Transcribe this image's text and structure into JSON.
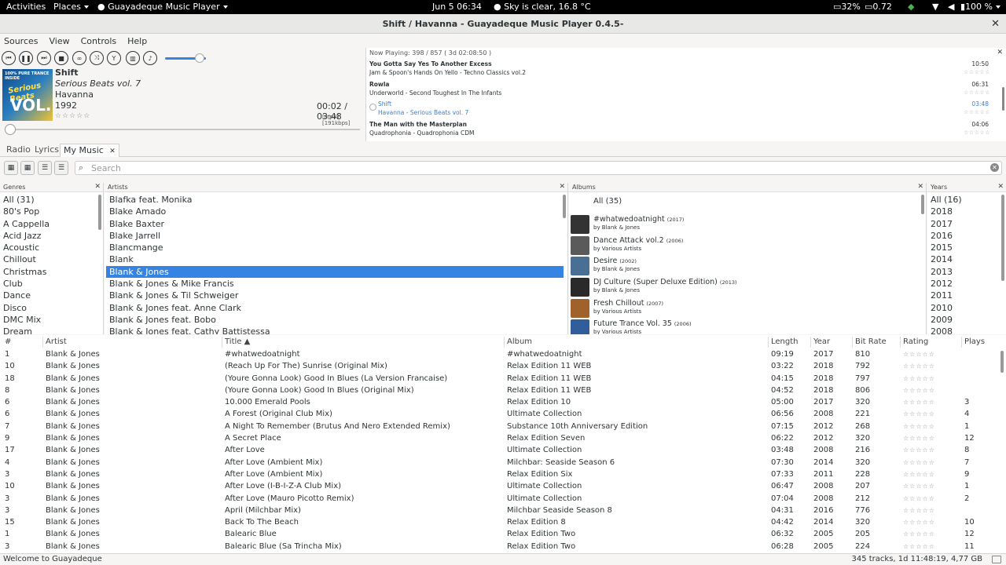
{
  "topbar": {
    "activities": "Activities",
    "places": "Places",
    "app_menu": "Guayadeque Music Player",
    "clock": "Jun 5  06:34",
    "weather": "Sky is clear, 16.8 °C",
    "cpu": "32%",
    "load": "0.72",
    "battery": "100 %"
  },
  "window": {
    "title": "Shift / Havanna - Guayadeque Music Player 0.4.5-"
  },
  "menu": [
    "Sources",
    "View",
    "Controls",
    "Help"
  ],
  "player": {
    "title": "Shift",
    "album": "Serious Beats vol. 7",
    "artist": "Havanna",
    "year": "1992",
    "rating": "☆☆☆☆☆",
    "time": "00:02 / 03:48",
    "format": "[mp3]  [191kbps]",
    "volume": 0.85,
    "cover_text": [
      "100% PURE TRANCE INSIDE",
      "Serious Beats",
      "VOL.7"
    ]
  },
  "now_playing": {
    "header": "Now Playing:  398 / 857   ( 3d 02:08:50 )",
    "tracks": [
      {
        "title": "You Gotta Say Yes To Another Excess",
        "sub": "Jam & Spoon's Hands On Yello - Techno Classics vol.2",
        "length": "10:50",
        "playing": false
      },
      {
        "title": "Rowla",
        "sub": "Underworld - Second Toughest In The Infants",
        "length": "06:31",
        "playing": false
      },
      {
        "title": "Shift",
        "sub": "Havanna - Serious Beats vol. 7",
        "length": "03:48",
        "playing": true
      },
      {
        "title": "The Man with the Masterplan",
        "sub": "Quadrophonia - Quadrophonia CDM",
        "length": "04:06",
        "playing": false
      }
    ]
  },
  "tabs": [
    "Radio",
    "Lyrics",
    "My Music"
  ],
  "search": {
    "placeholder": "Search"
  },
  "genres": {
    "header": "Genres",
    "items": [
      "All (31)",
      "80's Pop",
      "A Cappella",
      "Acid Jazz",
      "Acoustic",
      "Chillout",
      "Christmas",
      "Club",
      "Dance",
      "Disco",
      "DMC Mix",
      "Dream"
    ]
  },
  "artists": {
    "header": "Artists",
    "selected": 6,
    "items": [
      "Blafka feat. Monika",
      "Blake Amado",
      "Blake Baxter",
      "Blake Jarrell",
      "Blancmange",
      "Blank",
      "Blank & Jones",
      "Blank & Jones & Mike Francis",
      "Blank & Jones & Til Schweiger",
      "Blank & Jones feat. Anne Clark",
      "Blank & Jones feat. Bobo",
      "Blank & Jones feat. Cathy Battistessa"
    ]
  },
  "albums": {
    "header": "Albums",
    "all": "All (35)",
    "items": [
      {
        "name": "#whatwedoatnight",
        "year": "(2017)",
        "by": "by Blank & Jones",
        "color": "#333333"
      },
      {
        "name": "Dance Attack vol.2",
        "year": "(2006)",
        "by": "by Various Artists",
        "color": "#5a5a5a"
      },
      {
        "name": "Desire",
        "year": "(2002)",
        "by": "by Blank & Jones",
        "color": "#4a6f95"
      },
      {
        "name": "DJ Culture (Super Deluxe Edition)",
        "year": "(2013)",
        "by": "by Blank & Jones",
        "color": "#2a2a2a"
      },
      {
        "name": "Fresh Chillout",
        "year": "(2007)",
        "by": "by Various Artists",
        "color": "#a0622a"
      },
      {
        "name": "Future Trance Vol. 35",
        "year": "(2006)",
        "by": "by Various Artists",
        "color": "#2f5e9a"
      }
    ]
  },
  "years": {
    "header": "Years",
    "items": [
      "All (16)",
      "2018",
      "2017",
      "2016",
      "2015",
      "2014",
      "2013",
      "2012",
      "2011",
      "2010",
      "2009",
      "2008"
    ]
  },
  "table": {
    "columns": [
      "#",
      "Artist",
      "Title ▲",
      "Album",
      "Length",
      "Year",
      "Bit Rate",
      "Rating",
      "Plays"
    ],
    "rating_stars": "☆☆☆☆☆",
    "rows": [
      [
        "1",
        "Blank & Jones",
        "#whatwedoatnight",
        "#whatwedoatnight",
        "09:19",
        "2017",
        "810",
        ""
      ],
      [
        "10",
        "Blank & Jones",
        "(Reach Up For The) Sunrise (Original Mix)",
        "Relax Edition 11 WEB",
        "03:22",
        "2018",
        "792",
        ""
      ],
      [
        "18",
        "Blank & Jones",
        "(Youre Gonna Look) Good In Blues (La Version Francaise)",
        "Relax Edition 11 WEB",
        "04:15",
        "2018",
        "797",
        ""
      ],
      [
        "8",
        "Blank & Jones",
        "(Youre Gonna Look) Good In Blues (Original Mix)",
        "Relax Edition 11 WEB",
        "04:52",
        "2018",
        "806",
        ""
      ],
      [
        "6",
        "Blank & Jones",
        "10.000 Emerald Pools",
        "Relax Edition 10",
        "05:00",
        "2017",
        "320",
        "3"
      ],
      [
        "6",
        "Blank & Jones",
        "A Forest (Original Club Mix)",
        "Ultimate Collection",
        "06:56",
        "2008",
        "221",
        "4"
      ],
      [
        "7",
        "Blank & Jones",
        "A Night To Remember (Brutus And Nero Extended Remix)",
        "Substance  10th Anniversary Edition",
        "07:15",
        "2012",
        "268",
        "1"
      ],
      [
        "9",
        "Blank & Jones",
        "A Secret Place",
        "Relax Edition Seven",
        "06:22",
        "2012",
        "320",
        "12"
      ],
      [
        "17",
        "Blank & Jones",
        "After Love",
        "Ultimate Collection",
        "03:48",
        "2008",
        "216",
        "8"
      ],
      [
        "4",
        "Blank & Jones",
        "After Love (Ambient Mix)",
        "Milchbar: Seaside Season 6",
        "07:30",
        "2014",
        "320",
        "7"
      ],
      [
        "3",
        "Blank & Jones",
        "After Love (Ambient Mix)",
        "Relax Edition Six",
        "07:33",
        "2011",
        "228",
        "9"
      ],
      [
        "10",
        "Blank & Jones",
        "After Love (I-B-I-Z-A Club Mix)",
        "Ultimate Collection",
        "06:47",
        "2008",
        "207",
        "1"
      ],
      [
        "3",
        "Blank & Jones",
        "After Love (Mauro Picotto Remix)",
        "Ultimate Collection",
        "07:04",
        "2008",
        "212",
        "2"
      ],
      [
        "3",
        "Blank & Jones",
        "April (Milchbar Mix)",
        "Milchbar Seaside Season 8",
        "04:31",
        "2016",
        "776",
        ""
      ],
      [
        "15",
        "Blank & Jones",
        "Back To The Beach",
        "Relax Edition 8",
        "04:42",
        "2014",
        "320",
        "10"
      ],
      [
        "1",
        "Blank & Jones",
        "Balearic Blue",
        "Relax Edition Two",
        "06:32",
        "2005",
        "205",
        "12"
      ],
      [
        "3",
        "Blank & Jones",
        "Balearic Blue (Sa Trincha Mix)",
        "Relax Edition Two",
        "06:28",
        "2005",
        "224",
        "11"
      ]
    ]
  },
  "status": {
    "left": "Welcome to Guayadeque",
    "right": "345 tracks,   1d 11:48:19,   4,77 GB"
  }
}
